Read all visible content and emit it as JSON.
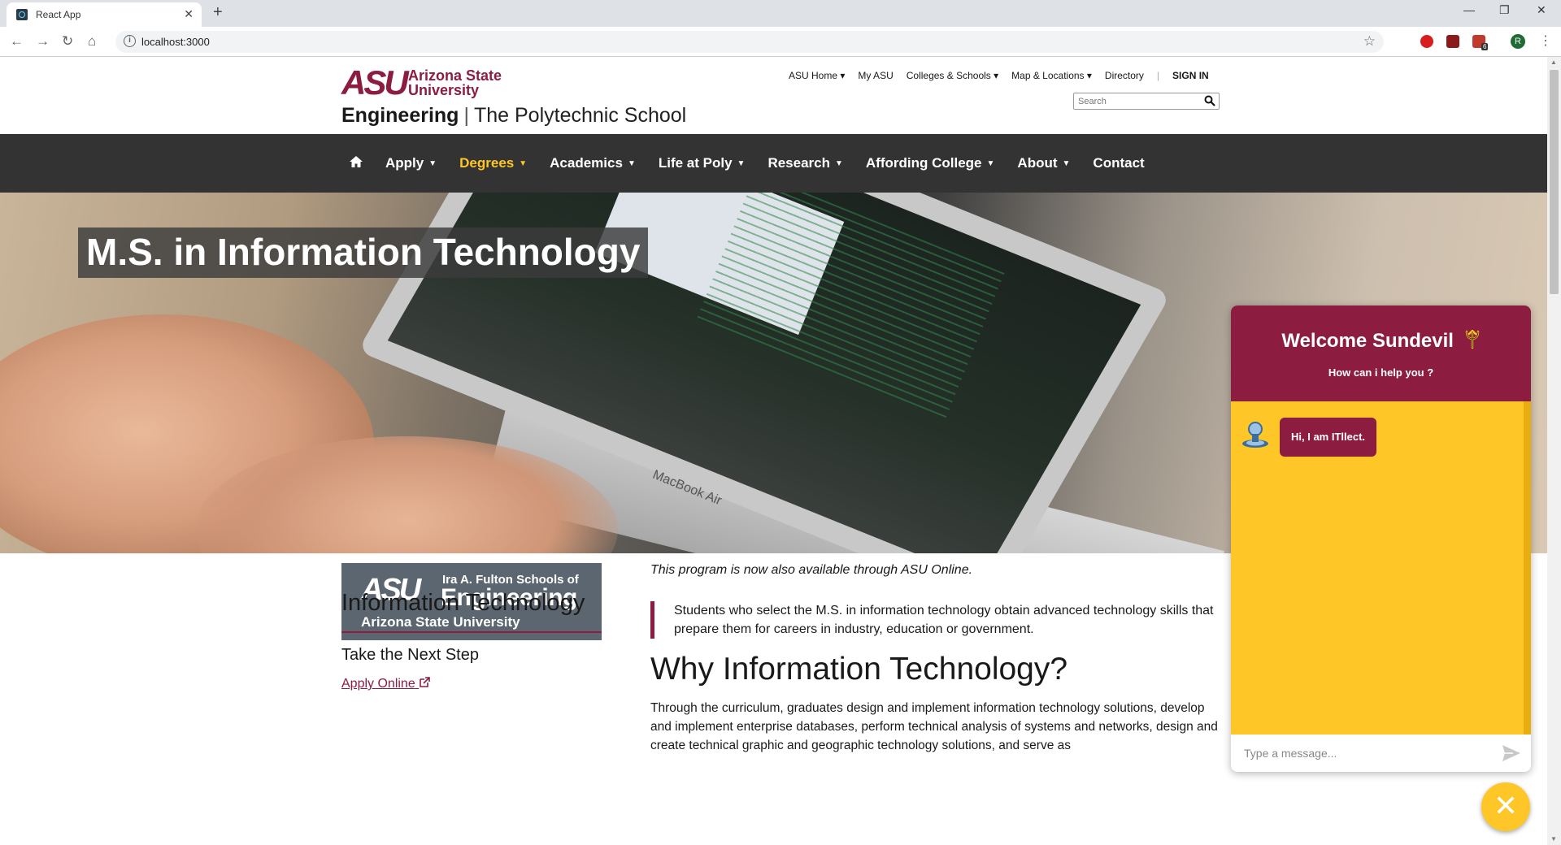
{
  "browser": {
    "tab_title": "React App",
    "url": "localhost:3000",
    "profile_initial": "R",
    "extension_badge": "6"
  },
  "header": {
    "university_name": "Arizona State University",
    "logo_mark": "ASU",
    "unit_main": "Engineering",
    "unit_separator": "|",
    "unit_sub": "The Polytechnic School",
    "utility_nav": [
      "ASU Home",
      "My ASU",
      "Colleges & Schools",
      "Map & Locations",
      "Directory",
      "SIGN IN"
    ],
    "search_placeholder": "Search"
  },
  "main_nav": {
    "items": [
      {
        "label": "Apply",
        "dropdown": true
      },
      {
        "label": "Degrees",
        "dropdown": true,
        "active": true
      },
      {
        "label": "Academics",
        "dropdown": true
      },
      {
        "label": "Life at Poly",
        "dropdown": true
      },
      {
        "label": "Research",
        "dropdown": true
      },
      {
        "label": "Affording College",
        "dropdown": true
      },
      {
        "label": "About",
        "dropdown": true
      },
      {
        "label": "Contact",
        "dropdown": false
      }
    ]
  },
  "hero": {
    "title": "M.S. in Information Technology",
    "laptop_brand": "MacBook Air"
  },
  "sidebar": {
    "logo_asu": "ASU",
    "logo_line1": "Ira A. Fulton Schools of",
    "logo_line2": "Engineering",
    "logo_line3": "Arizona State University",
    "program_title": "Information Technology",
    "next_step": "Take the Next Step",
    "apply_link": "Apply Online"
  },
  "content": {
    "intro": "This program is now also available through ASU Online.",
    "quote": "Students who select the M.S. in information technology obtain advanced technology skills that prepare them for careers in industry, education or government.",
    "section_title": "Why Information Technology?",
    "body": "Through the curriculum, graduates design and implement information technology solutions, develop and implement enterprise databases, perform technical analysis of systems and networks, design and create technical graphic and geographic technology solutions, and serve as"
  },
  "chat": {
    "title": "Welcome Sundevil",
    "subtitle": "How can i help you ?",
    "bot_message": "Hi, I am ITllect.",
    "input_placeholder": "Type a message..."
  },
  "colors": {
    "maroon": "#8c1d40",
    "gold": "#ffc627",
    "nav_bg": "#333333"
  }
}
